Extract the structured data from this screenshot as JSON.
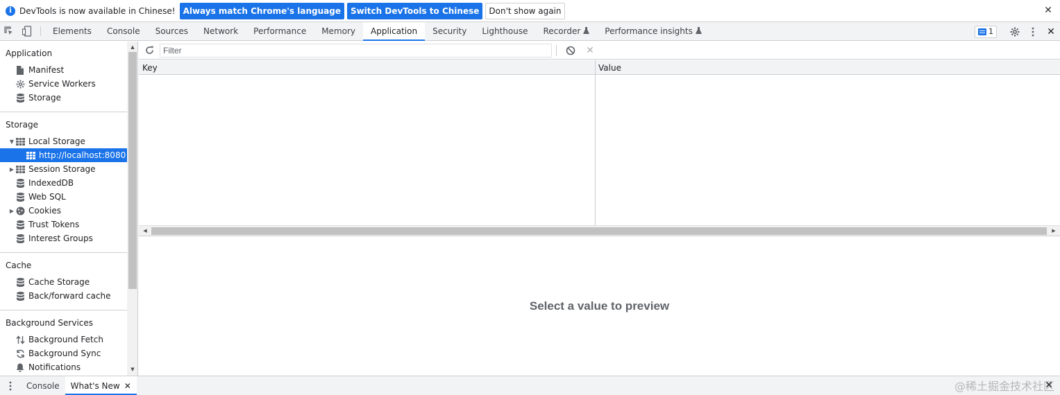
{
  "infobar": {
    "info_icon": "info-icon",
    "message": "DevTools is now available in Chinese!",
    "match_language_label": "Always match Chrome's language",
    "switch_label": "Switch DevTools to Chinese",
    "dont_show_label": "Don't show again",
    "close_icon": "close-icon"
  },
  "tabs": [
    {
      "label": "Elements"
    },
    {
      "label": "Console"
    },
    {
      "label": "Sources"
    },
    {
      "label": "Network"
    },
    {
      "label": "Performance"
    },
    {
      "label": "Memory"
    },
    {
      "label": "Application",
      "active": true
    },
    {
      "label": "Security"
    },
    {
      "label": "Lighthouse"
    },
    {
      "label": "Recorder",
      "experimental": true
    },
    {
      "label": "Performance insights",
      "experimental": true
    }
  ],
  "toolbar_right": {
    "issues_count": "1"
  },
  "sidebar": {
    "sections": [
      {
        "title": "Application",
        "items": [
          "Manifest",
          "Service Workers",
          "Storage"
        ]
      },
      {
        "title": "Storage",
        "items": [
          "Local Storage",
          "http://localhost:8080",
          "Session Storage",
          "IndexedDB",
          "Web SQL",
          "Cookies",
          "Trust Tokens",
          "Interest Groups"
        ]
      },
      {
        "title": "Cache",
        "items": [
          "Cache Storage",
          "Back/forward cache"
        ]
      },
      {
        "title": "Background Services",
        "items": [
          "Background Fetch",
          "Background Sync",
          "Notifications"
        ]
      }
    ],
    "selected": "http://localhost:8080"
  },
  "storage_toolbar": {
    "filter_placeholder": "Filter"
  },
  "grid": {
    "columns": [
      "Key",
      "Value"
    ],
    "rows": []
  },
  "preview": {
    "message": "Select a value to preview"
  },
  "drawer": {
    "tabs": [
      {
        "label": "Console"
      },
      {
        "label": "What's New",
        "active": true,
        "closable": true
      }
    ]
  },
  "watermark": "@稀土掘金技术社区",
  "colors": {
    "accent": "#1a73e8",
    "toolbar_bg": "#f1f3f4",
    "border": "#cbcdd1"
  }
}
